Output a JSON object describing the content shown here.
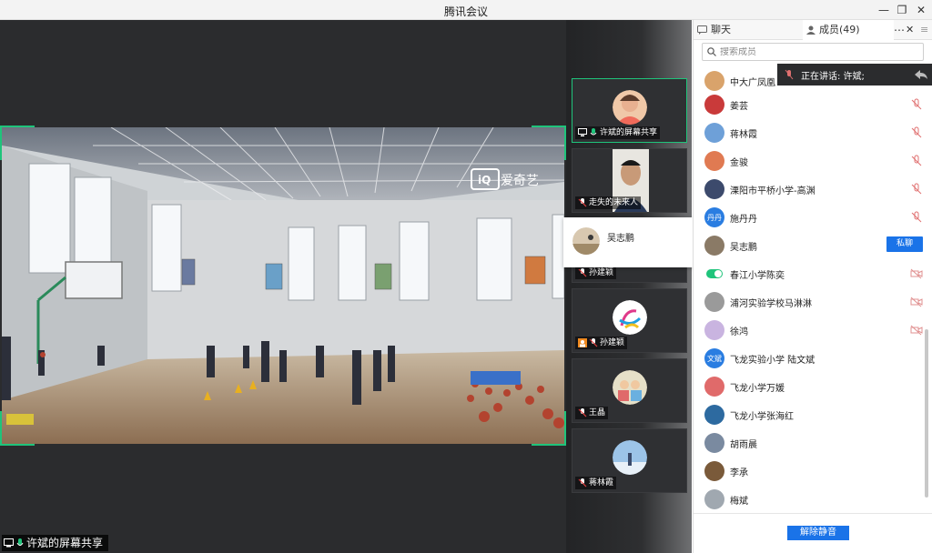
{
  "window": {
    "title": "腾讯会议"
  },
  "stage": {
    "watermark": "爱奇艺",
    "share_label": "许斌的屏幕共享"
  },
  "thumbs": [
    {
      "name": "许斌的屏幕共享",
      "active": true
    },
    {
      "name": "走失的未来人"
    },
    {
      "name": "孙建颖"
    },
    {
      "name": "孙建颖"
    },
    {
      "name": "王晶"
    },
    {
      "name": "蒋林霞"
    }
  ],
  "hover_card": {
    "name": "吴志鹏"
  },
  "panel": {
    "tabs": {
      "chat": "聊天",
      "members": "成员(49)"
    },
    "search_placeholder": "搜索成员",
    "speaking": "正在讲话: 许斌;",
    "members": [
      {
        "name": "中大广凤凰",
        "avatar_color": "#d9a36b"
      },
      {
        "name": "姜芸",
        "avatar_color": "#c93a3a"
      },
      {
        "name": "蒋林霞",
        "avatar_color": "#6ea0d8"
      },
      {
        "name": "金骏",
        "avatar_color": "#e07a52"
      },
      {
        "name": "溧阳市平桥小学-高渊",
        "avatar_color": "#3c4a6c"
      },
      {
        "name": "施丹丹",
        "avatar_text": "丹丹",
        "avatar_color": "#2a7de1"
      },
      {
        "name": "吴志鹏",
        "avatar_color": "#8a7a66"
      },
      {
        "name": "春江小学陈奕"
      },
      {
        "name": "浦河实验学校马淋淋",
        "avatar_color": "#9a9a9a"
      },
      {
        "name": "徐鸿",
        "avatar_color": "#c9b4e0"
      },
      {
        "name": "飞龙实验小学 陆文斌",
        "avatar_text": "文斌",
        "avatar_color": "#2a7de1"
      },
      {
        "name": "飞龙小学万媛",
        "avatar_color": "#e06a6a"
      },
      {
        "name": "飞龙小学张海红",
        "avatar_color": "#2d6aa0"
      },
      {
        "name": "胡雨晨",
        "avatar_color": "#7a8aa0"
      },
      {
        "name": "李承",
        "avatar_color": "#7a5a3a"
      },
      {
        "name": "梅斌",
        "avatar_color": "#a0a8b0"
      }
    ],
    "dm_label": "私聊",
    "unmute_label": "解除静音"
  }
}
